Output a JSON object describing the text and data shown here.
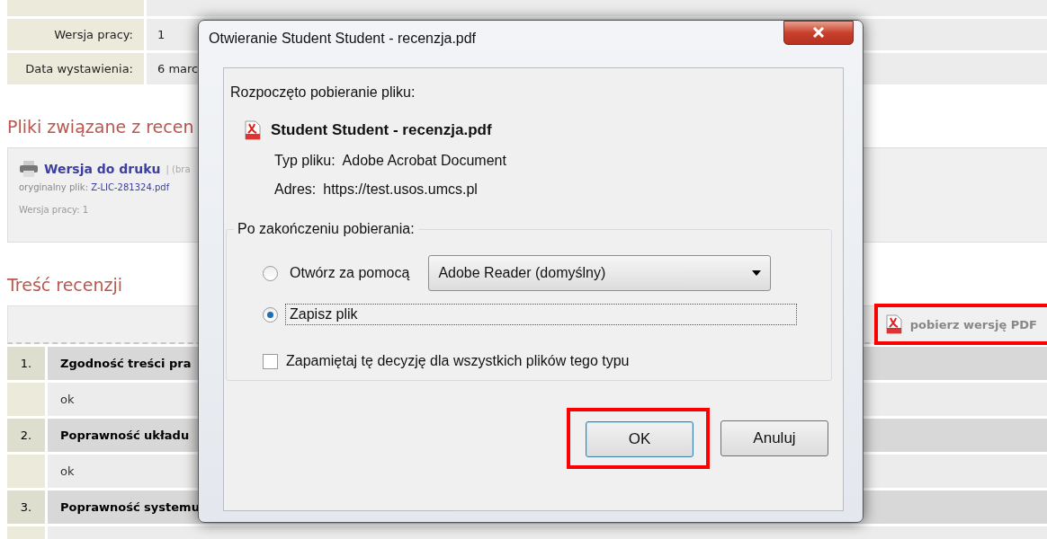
{
  "page": {
    "details": [
      {
        "label": "Wersja pracy:",
        "value": "1"
      },
      {
        "label": "Data wystawienia:",
        "value": "6 marc"
      }
    ],
    "files_heading": "Pliki związane z recen",
    "file_card": {
      "link": "Wersja do druku",
      "note": "| (bra",
      "original_label": "oryginalny plik:",
      "original_file": "Z-LIC-281324.pdf",
      "version": "Wersja pracy: 1"
    },
    "review_heading": "Treść recenzji",
    "review_table": {
      "pdf_link": "pobierz wersję PDF",
      "rows": [
        {
          "kind": "question",
          "number": "1.",
          "text": "Zgodność treści pra"
        },
        {
          "kind": "answer",
          "text": "ok"
        },
        {
          "kind": "question",
          "number": "2.",
          "text": "Poprawność układu"
        },
        {
          "kind": "answer",
          "text": "ok"
        },
        {
          "kind": "question",
          "number": "3.",
          "text": "Poprawność systemu"
        },
        {
          "kind": "answer",
          "text": ""
        }
      ]
    }
  },
  "dialog": {
    "title": "Otwieranie Student Student - recenzja.pdf",
    "intro": "Rozpoczęto pobieranie pliku:",
    "file_name": "Student Student - recenzja.pdf",
    "file_type_label": "Typ pliku:",
    "file_type": "Adobe Acrobat Document",
    "address_label": "Adres:",
    "address": "https://test.usos.umcs.pl",
    "after_download": {
      "legend": "Po zakończeniu pobierania:",
      "options": [
        {
          "label": "Otwórz za pomocą",
          "selected": false,
          "focused": false,
          "app": "Adobe Reader  (domyślny)"
        },
        {
          "label": "Zapisz plik",
          "selected": true,
          "focused": true
        }
      ],
      "remember": {
        "label": "Zapamiętaj tę decyzję dla wszystkich plików tego typu",
        "checked": false
      }
    },
    "buttons": [
      {
        "label": "OK",
        "default": true,
        "highlighted": true
      },
      {
        "label": "Anuluj",
        "default": false,
        "highlighted": false
      }
    ]
  }
}
